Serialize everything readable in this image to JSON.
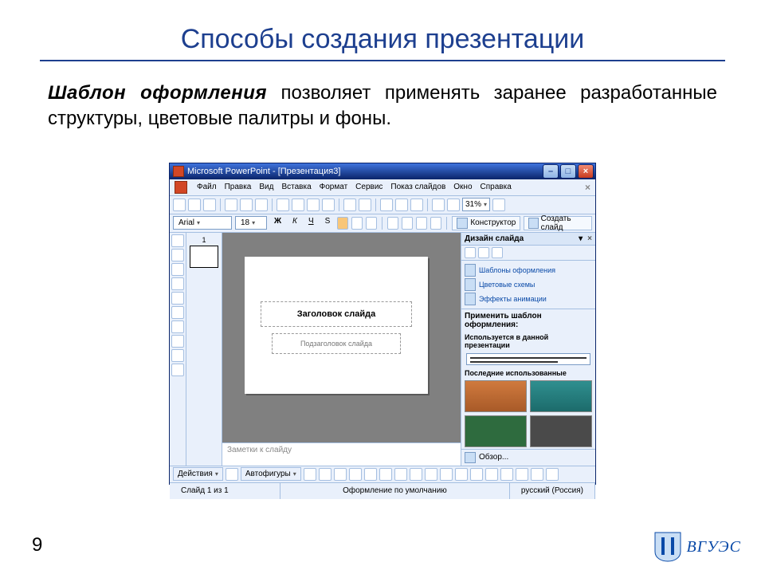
{
  "slide": {
    "title": "Способы создания презентации",
    "body_lead": "Шаблон оформления",
    "body_rest": " позволяет применять заранее разработанные структуры, цветовые палитры и фоны.",
    "page_number": "9",
    "brand": "ВГУЭС"
  },
  "pp": {
    "title": "Microsoft PowerPoint - [Презентация3]",
    "menu": [
      "Файл",
      "Правка",
      "Вид",
      "Вставка",
      "Формат",
      "Сервис",
      "Показ слайдов",
      "Окно",
      "Справка"
    ],
    "zoom": "31%",
    "font_name": "Arial",
    "font_size": "18",
    "bold": "Ж",
    "italic": "К",
    "underline": "Ч",
    "shadow": "S",
    "cmd_designer": "Конструктор",
    "cmd_new_slide": "Создать слайд",
    "thumb_index": "1",
    "placeholder_title": "Заголовок слайда",
    "placeholder_sub": "Подзаголовок слайда",
    "notes": "Заметки к слайду",
    "task": {
      "title": "Дизайн слайда",
      "links": [
        "Шаблоны оформления",
        "Цветовые схемы",
        "Эффекты анимации"
      ],
      "apply": "Применить шаблон оформления:",
      "used": "Используется в данной презентации",
      "recent": "Последние использованные",
      "browse": "Обзор..."
    },
    "draw": {
      "actions": "Действия",
      "autoshapes": "Автофигуры"
    },
    "status": {
      "slide": "Слайд 1 из 1",
      "design": "Оформление по умолчанию",
      "lang": "русский (Россия)"
    }
  }
}
